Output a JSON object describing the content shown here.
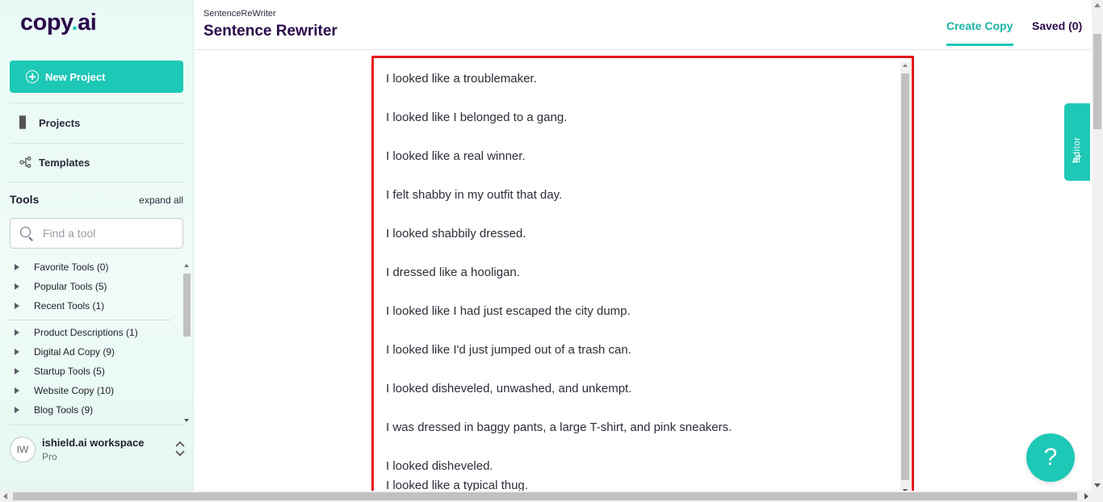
{
  "sidebar": {
    "logo_main": "copy",
    "logo_dot": ".",
    "logo_suffix": "ai",
    "new_project_label": "New Project",
    "nav": {
      "projects_label": "Projects",
      "templates_label": "Templates"
    },
    "tools_title": "Tools",
    "expand_all_label": "expand all",
    "search_placeholder": "Find a tool",
    "tool_groups": [
      "Favorite Tools (0)",
      "Popular Tools (5)",
      "Recent Tools (1)",
      "Product Descriptions (1)",
      "Digital Ad Copy (9)",
      "Startup Tools (5)",
      "Website Copy (10)",
      "Blog Tools (9)"
    ],
    "workspace": {
      "avatar_initials": "IW",
      "name": "ishield.ai workspace",
      "plan": "Pro"
    }
  },
  "header": {
    "breadcrumb": "SentenceReWriter",
    "title": "Sentence Rewriter",
    "tab_create": "Create Copy",
    "tab_saved": "Saved (0)"
  },
  "editor": {
    "side_tab_label": "Editor",
    "lines": [
      "I looked like a troublemaker.",
      "",
      "I looked like I belonged to a gang.",
      "",
      "I looked like a real winner.",
      "",
      "I felt shabby in my outfit that day.",
      "",
      "I looked shabbily dressed.",
      "",
      "I dressed like a hooligan.",
      "",
      "I looked like I had just escaped the city dump.",
      "",
      "I looked like I'd just jumped out of a trash can.",
      "",
      "I looked disheveled, unwashed, and unkempt.",
      "",
      "I was dressed in baggy pants, a large T-shirt, and pink sneakers.",
      "",
      "I looked disheveled.",
      "I looked like a typical thug."
    ]
  },
  "help_label": "?",
  "colors": {
    "brand_teal": "#1ec8b6",
    "brand_purple": "#2a0a4a",
    "editor_border": "#e5141c"
  }
}
